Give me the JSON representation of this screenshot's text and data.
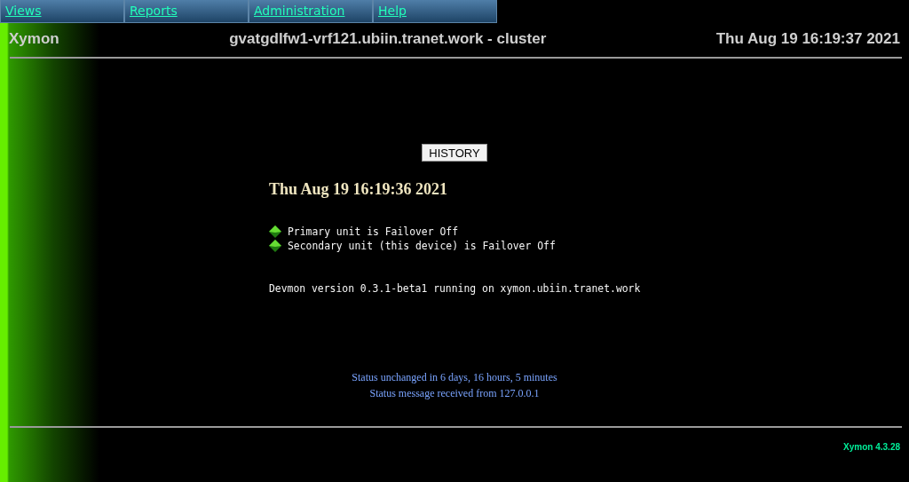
{
  "menu": [
    {
      "label": "Views"
    },
    {
      "label": "Reports"
    },
    {
      "label": "Administration"
    },
    {
      "label": "Help"
    }
  ],
  "header": {
    "brand": "Xymon",
    "title": "gvatgdlfw1-vrf121.ubiin.tranet.work - cluster",
    "datetime": "Thu Aug 19 16:19:37 2021"
  },
  "history_button": "HISTORY",
  "status_time": "Thu Aug 19 16:19:36 2021",
  "status_items": [
    {
      "kind": "ok",
      "text": "Primary unit is Failover Off"
    },
    {
      "kind": "ok",
      "text": "Secondary unit (this device) is Failover Off"
    }
  ],
  "devmon_line": "Devmon version 0.3.1-beta1 running on xymon.ubiin.tranet.work",
  "status_notes": [
    "Status unchanged in 6 days, 16 hours, 5 minutes",
    "Status message received from 127.0.0.1"
  ],
  "footer": "Xymon 4.3.28"
}
